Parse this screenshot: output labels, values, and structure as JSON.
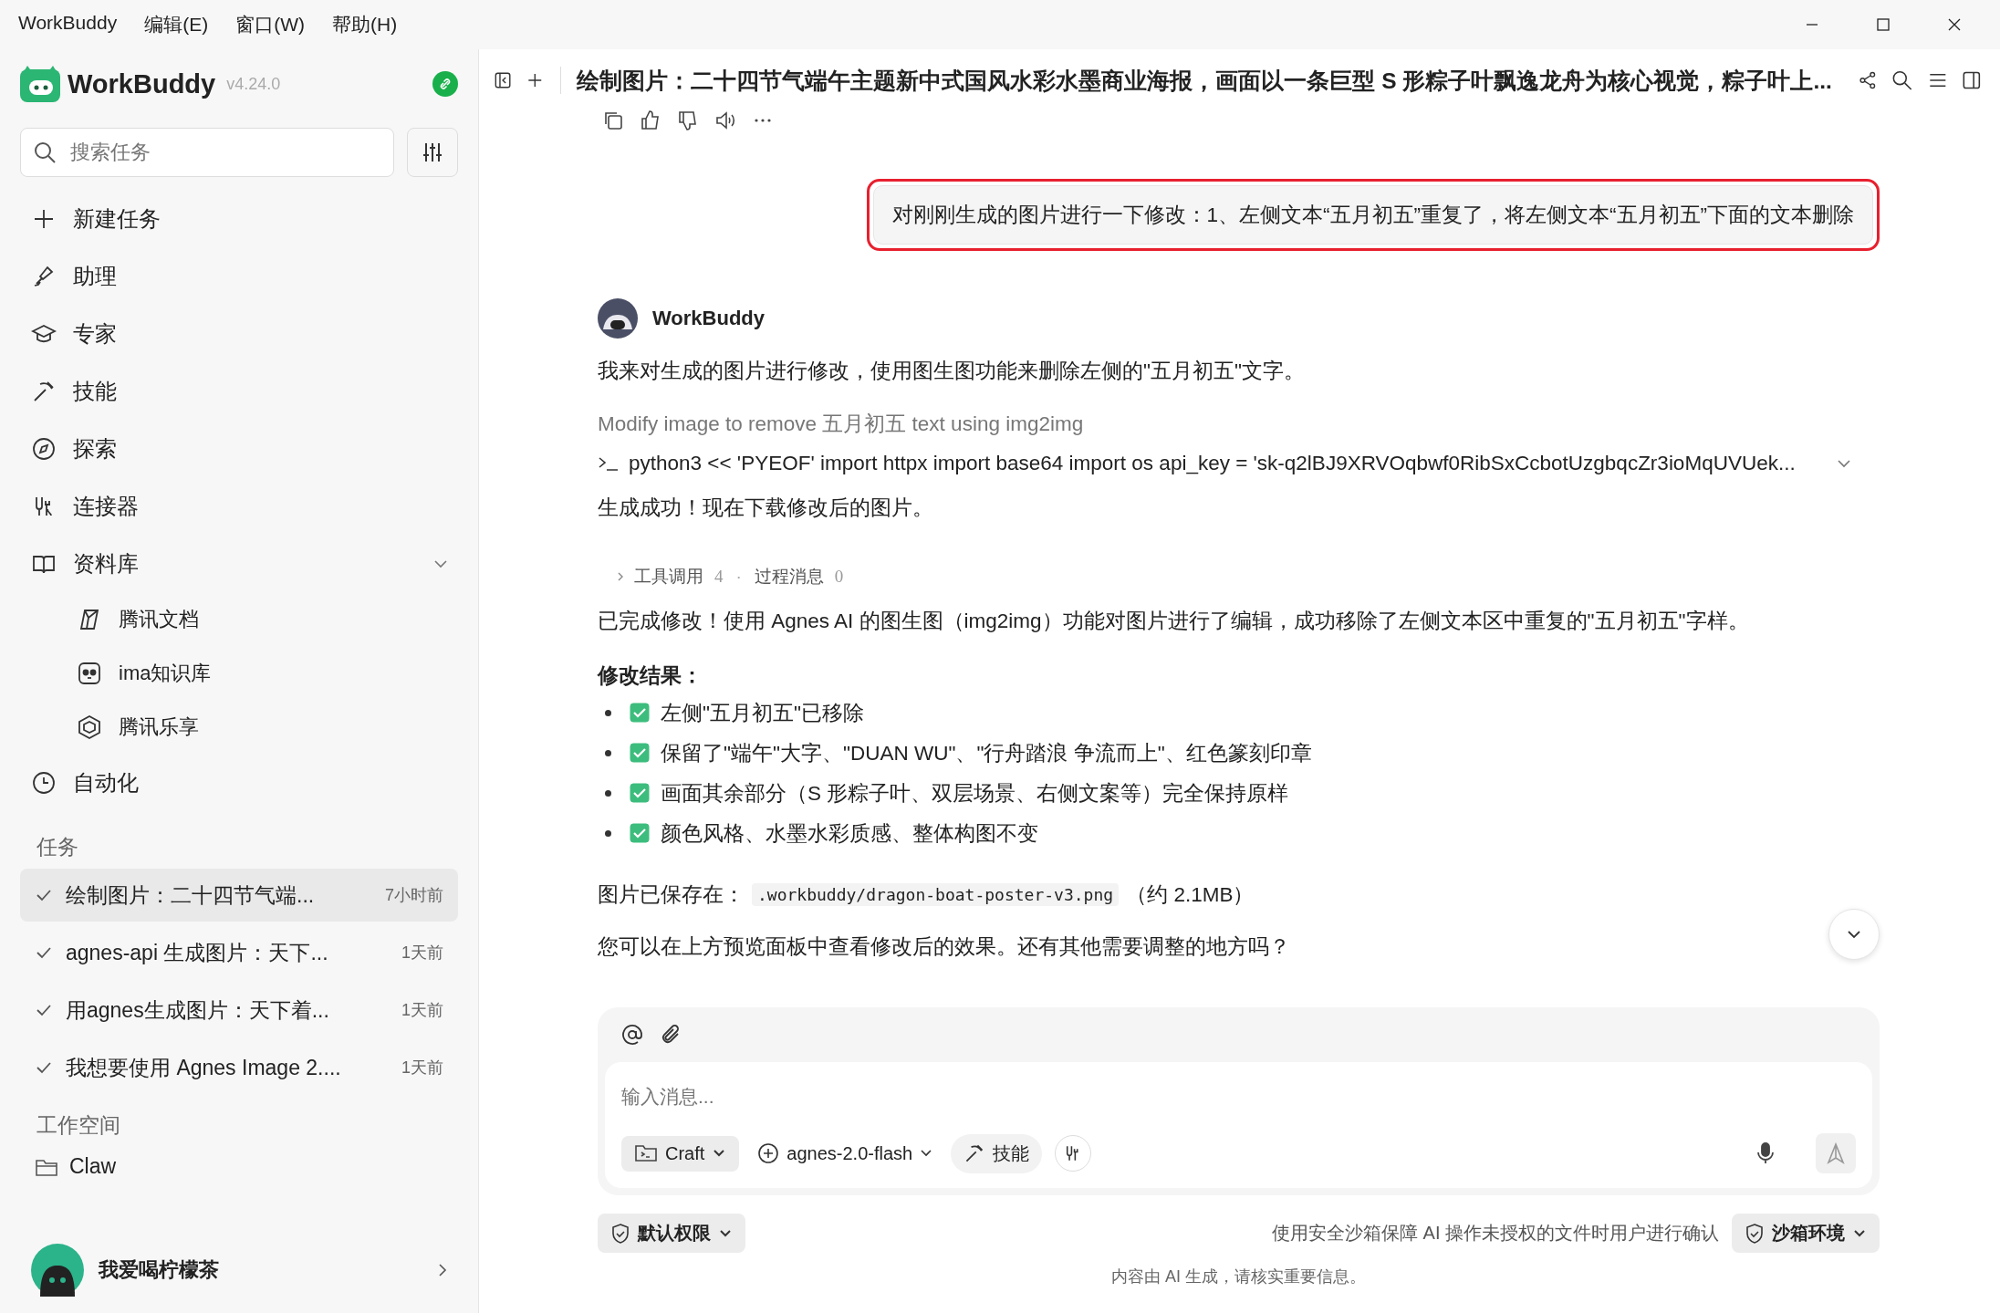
{
  "menu": [
    "WorkBuddy",
    "编辑(E)",
    "窗口(W)",
    "帮助(H)"
  ],
  "sidebar": {
    "brand": "WorkBuddy",
    "version": "v4.24.0",
    "search": {
      "placeholder": "搜索任务"
    },
    "nav": [
      {
        "label": "新建任务"
      },
      {
        "label": "助理"
      },
      {
        "label": "专家"
      },
      {
        "label": "技能"
      },
      {
        "label": "探索"
      },
      {
        "label": "连接器"
      },
      {
        "label": "资料库",
        "expanded": true,
        "children": [
          {
            "label": "腾讯文档"
          },
          {
            "label": "ima知识库"
          },
          {
            "label": "腾讯乐享"
          }
        ]
      },
      {
        "label": "自动化"
      }
    ],
    "tasks_heading": "任务",
    "tasks": [
      {
        "label": "绘制图片：二十四节气端...",
        "time": "7小时前",
        "done": true,
        "selected": true
      },
      {
        "label": "agnes-api 生成图片：天下...",
        "time": "1天前",
        "done": true,
        "selected": false
      },
      {
        "label": "用agnes生成图片：天下着...",
        "time": "1天前",
        "done": true,
        "selected": false
      },
      {
        "label": "我想要使用 Agnes Image 2....",
        "time": "1天前",
        "done": true,
        "selected": false
      }
    ],
    "workspace_heading": "工作空间",
    "workspaces": [
      "Claw"
    ],
    "user": "我爱喝柠檬茶"
  },
  "chat": {
    "title": "绘制图片：二十四节气端午主题新中式国风水彩水墨商业海报，画面以一条巨型 S 形粽子叶飘逸龙舟为核心视觉，粽子叶上...",
    "user_message": {
      "text": "对刚刚生成的图片进行一下修改：1、左侧文本“五月初五”重复了，将左侧文本“五月初五”下面的文本删除",
      "highlighted": true
    },
    "assistant": {
      "name": "WorkBuddy",
      "intro": "我来对生成的图片进行修改，使用图生图功能来删除左侧的\"五月初五\"文字。",
      "step_title": "Modify image to remove 五月初五 text using img2img",
      "command": "python3 << 'PYEOF' import httpx import base64 import os api_key = 'sk-q2lBJ9XRVOqbwf0RibSxCcbotUzgbqcZr3ioMqUVUek...",
      "status": "生成成功！现在下载修改后的图片。",
      "summary": {
        "tools_label": "工具调用",
        "tools_count": "4",
        "separator": "·",
        "process_label": "过程消息",
        "process_count": "0",
        "expanded": false
      },
      "done": "已完成修改！使用 Agnes AI 的图生图（img2img）功能对图片进行了编辑，成功移除了左侧文本区中重复的\"五月初五\"字样。",
      "result_heading": "修改结果：",
      "results": [
        {
          "text": "左侧\"五月初五\"已移除",
          "checked": true
        },
        {
          "text": "保留了\"端午\"大字、\"DUAN WU\"、\"行舟踏浪 争流而上\"、红色篆刻印章",
          "checked": true
        },
        {
          "text": "画面其余部分（S 形粽子叶、双层场景、右侧文案等）完全保持原样",
          "checked": true
        },
        {
          "text": "颜色风格、水墨水彩质感、整体构图不变",
          "checked": true
        }
      ],
      "saved_prefix": "图片已保存在：",
      "saved_path": ".workbuddy/dragon-boat-poster-v3.png",
      "saved_suffix": "（约 2.1MB）",
      "question": "您可以在上方预览面板中查看修改后的效果。还有其他需要调整的地方吗？"
    }
  },
  "composer": {
    "placeholder": "输入消息...",
    "mode": "Craft",
    "model": "agnes-2.0-flash",
    "skill": "技能",
    "permission": "默认权限",
    "sandbox_note": "使用安全沙箱保障 AI 操作未授权的文件时用户进行确认",
    "sandbox": "沙箱环境",
    "disclaimer": "内容由 AI 生成，请核实重要信息。"
  }
}
